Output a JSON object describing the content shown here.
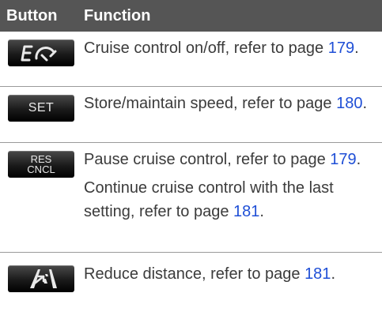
{
  "header": {
    "col_button": "Button",
    "col_function": "Function"
  },
  "rows": [
    {
      "button_icon": "cruise-control-icon",
      "lines": [
        {
          "text": "Cruise control on/off, refer to page ",
          "page": "179",
          "after": "."
        }
      ]
    },
    {
      "button_label": "SET",
      "lines": [
        {
          "text": "Store/maintain speed, refer to page ",
          "page": "180",
          "after": "."
        }
      ]
    },
    {
      "button_label_line1": "RES",
      "button_label_line2": "CNCL",
      "lines": [
        {
          "text": "Pause cruise control, refer to page ",
          "page": "179",
          "after": "."
        },
        {
          "text": "Continue cruise control with the last setting, refer to page ",
          "page": "181",
          "after": "."
        }
      ]
    },
    {
      "button_icon": "distance-icon",
      "lines": [
        {
          "text": "Reduce distance, refer to page ",
          "page": "181",
          "after": "."
        }
      ]
    }
  ],
  "colors": {
    "header_bg": "#555555",
    "link": "#1f4fd6",
    "text": "#3b3b3b"
  }
}
